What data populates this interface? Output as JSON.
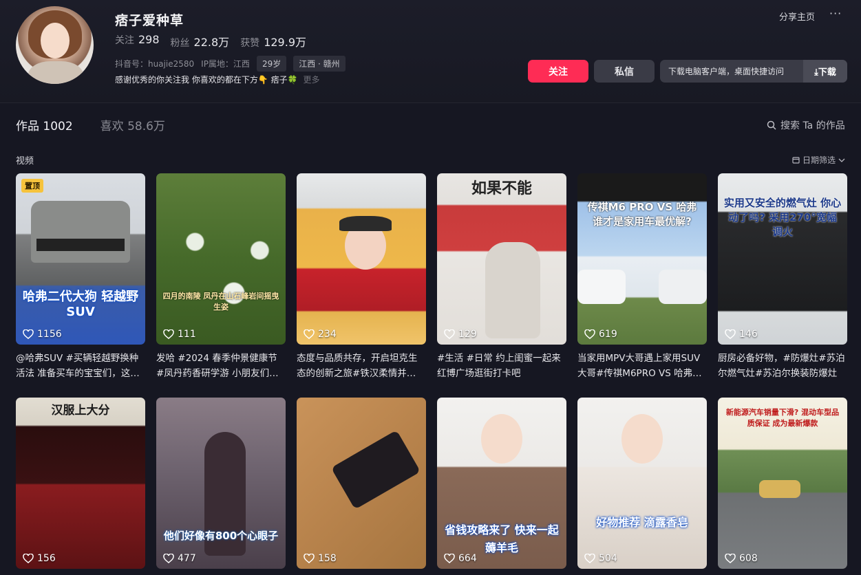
{
  "profile": {
    "name": "痞子爱种草",
    "stats": [
      {
        "label": "关注",
        "value": "298"
      },
      {
        "label": "粉丝",
        "value": "22.8万"
      },
      {
        "label": "获赞",
        "value": "129.9万"
      }
    ],
    "douyin_id": "抖音号：huajie2580",
    "ip_location": "IP属地：江西",
    "tags": [
      "29岁",
      "江西 · 赣州"
    ],
    "bio": "感谢优秀的你关注我 你喜欢的都在下方👇 痞子🍀",
    "bio_more": "更多"
  },
  "header_actions": {
    "share": "分享主页",
    "more": "···",
    "follow": "关注",
    "message": "私信",
    "download_text": "下载电脑客户端，桌面快捷访问",
    "download_btn": "⤓下载"
  },
  "tabs": [
    {
      "label": "作品 1002",
      "active": true
    },
    {
      "label": "喜欢 58.6万",
      "active": false
    }
  ],
  "search_label": "搜索 Ta 的作品",
  "section_label": "视频",
  "filter_label": "日期筛选",
  "pinned_label": "置顶",
  "videos": [
    {
      "likes": "1156",
      "caption": "@哈弗SUV #买辆轻越野换种活法 准备买车的宝宝们，这…",
      "overlay": "哈弗二代大狗 轻越野SUV"
    },
    {
      "likes": "111",
      "caption": "发哈 #2024 春季仲景健康节 #凤丹药香研学游 小朋友们…",
      "overlay": "四月的南陵 凤丹在山石峰岩间摇曳生姿"
    },
    {
      "likes": "234",
      "caption": "态度与品质共存，开启坦克生态的创新之旅#铁汉柔情并…",
      "overlay": ""
    },
    {
      "likes": "129",
      "caption": "#生活 #日常 约上闺蜜一起来红博广场逛街打卡吧",
      "overlay": "如果不能"
    },
    {
      "likes": "619",
      "caption": "当家用MPV大哥遇上家用SUV大哥#传祺M6PRO VS 哈弗…",
      "overlay": "传祺M6 PRO VS 哈弗 谁才是家用车最优解?"
    },
    {
      "likes": "146",
      "caption": "厨房必备好物，#防爆灶#苏泊尔燃气灶#苏泊尔换装防爆灶",
      "overlay": "实用又安全的燃气灶 你心动了吗? 采用270°宽幅调火"
    },
    {
      "likes": "156",
      "caption": "",
      "overlay": "汉服上大分"
    },
    {
      "likes": "477",
      "caption": "",
      "overlay": "他们好像有800个心眼子"
    },
    {
      "likes": "158",
      "caption": "",
      "overlay": ""
    },
    {
      "likes": "664",
      "caption": "",
      "overlay": "省钱攻略来了 快来一起薅羊毛"
    },
    {
      "likes": "504",
      "caption": "",
      "overlay": "好物推荐 滴露香皂"
    },
    {
      "likes": "608",
      "caption": "",
      "overlay": "新能源汽车销量下滑? 混动车型品质保证 成为最新爆款"
    }
  ],
  "colors": {
    "background": "#161722",
    "accent": "#fe2c55",
    "button_secondary": "#3a3b46"
  }
}
